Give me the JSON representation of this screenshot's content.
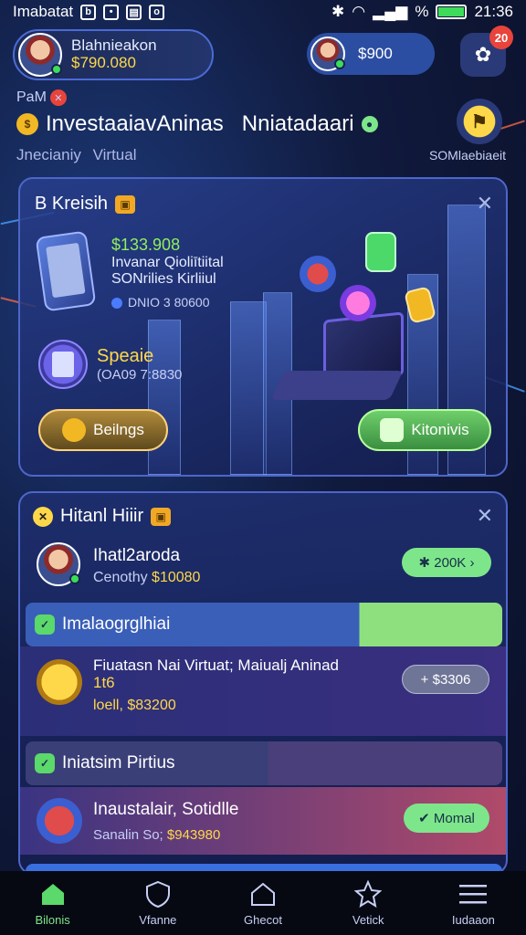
{
  "status_bar": {
    "carrier": "Imabatat",
    "time": "21:36",
    "battery_label": "%"
  },
  "profile": {
    "name": "Blahnieakon",
    "amount": "$790.080"
  },
  "balance": {
    "value": "$900"
  },
  "notifications": {
    "count": "20"
  },
  "header": {
    "small_label": "PaM",
    "title": "InvestaaiavAninas",
    "title_right": "Nniatadaari",
    "subtitle": "Jnecianiy",
    "subtitle_right": "Virtual",
    "trophy_label": "SOMlaebiaeit"
  },
  "hero_card": {
    "title": "B Kreisih",
    "amount": "$133.908",
    "line1": "Invanar Qioliītiital",
    "line2": "SONrilies Kirliiul",
    "meta": "DNIO 3 80600",
    "item_name": "Speaie",
    "item_time": "(OA09 7:8830",
    "button_left": "Beilngs",
    "button_right": "Kitonivis"
  },
  "list_card": {
    "title": "Hitanl Hiiir",
    "user_row": {
      "name": "Ihatl2aroda",
      "label": "Cenothy",
      "amount": "$10080",
      "pill": "✱ 200K ›"
    },
    "section1": "Imalaogrglhiai",
    "coin_row": {
      "title": "Fiuatasn Nai Virtuat; Maiualj Aninad",
      "sub": "1t6",
      "amount": "loell, $83200",
      "pill": "+ $3306"
    },
    "section2": "Iniatsim Pirtius",
    "ticket_row": {
      "title": "Inaustalair, Sotidlle",
      "label": "Sanalin So;",
      "amount": "$943980",
      "pill": "✔ Momal"
    }
  },
  "bottom_nav": [
    {
      "label": "Bilonis"
    },
    {
      "label": "Vfanne"
    },
    {
      "label": "Ghecot"
    },
    {
      "label": "Vetick"
    },
    {
      "label": "Iudaaon"
    }
  ],
  "colors": {
    "accent_green": "#7ee68a",
    "accent_gold": "#ffd84a",
    "card_border": "#4d66c9"
  }
}
